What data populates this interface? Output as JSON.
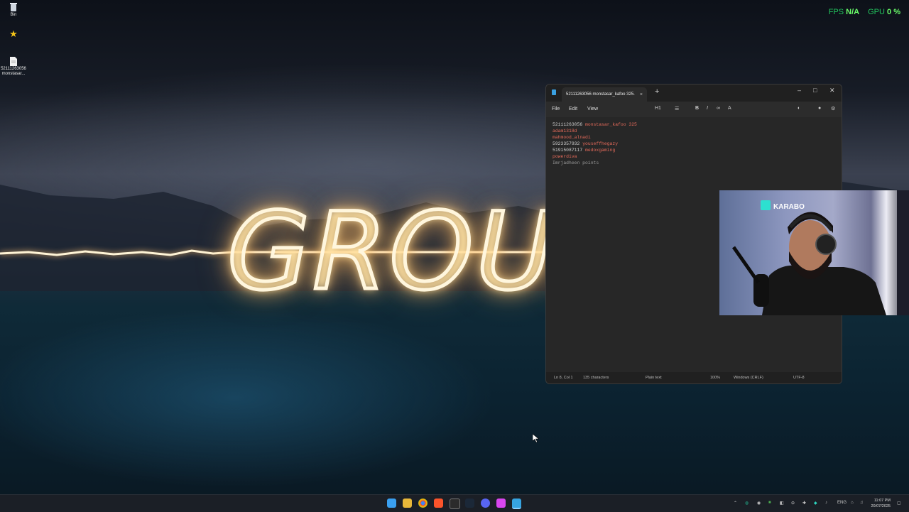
{
  "desktop": {
    "icons": [
      {
        "label": "Bin"
      },
      {
        "label": ""
      },
      {
        "label": "52111263056 monstasar..."
      }
    ],
    "wallpaper_text": "GROUND"
  },
  "overlay": {
    "fps_label": "FPS",
    "fps_value": "N/A",
    "gpu_label": "GPU",
    "gpu_value": "0 %"
  },
  "notepad": {
    "tab_title": "52111263056 monstasar_kafoo 325.",
    "tab_close": "×",
    "new_tab": "+",
    "window_controls": {
      "minimize": "–",
      "maximize": "□",
      "close": "✕"
    },
    "menu": [
      "File",
      "Edit",
      "View"
    ],
    "heading_tool": "H1",
    "lines": [
      {
        "num": "52111263056",
        "text": "monstasar_kafoo 325"
      },
      {
        "num": "",
        "text": "adam1318d"
      },
      {
        "num": "",
        "text": "mahmood_alnadi"
      },
      {
        "num": "5923357932",
        "text": "youseffhegazy"
      },
      {
        "num": "51915087117",
        "text": "medoxgaming"
      },
      {
        "num": "",
        "text": "powerdiva"
      },
      {
        "num": "",
        "text": "Imrjadheen points"
      }
    ],
    "status": {
      "position": "Ln 8, Col 1",
      "chars": "135 characters",
      "format": "Plain text",
      "zoom": "100%",
      "line_endings": "Windows (CRLF)",
      "encoding": "UTF-8"
    }
  },
  "webcam": {
    "sign_text": "KARABO"
  },
  "taskbar": {
    "language": "ENG",
    "time": "11:07 PM",
    "date": "20/07/2025"
  },
  "colors": {
    "overlay_green": "#22c55e",
    "notepad_bg": "#272727",
    "taskbar_bg": "#1b1f26"
  }
}
